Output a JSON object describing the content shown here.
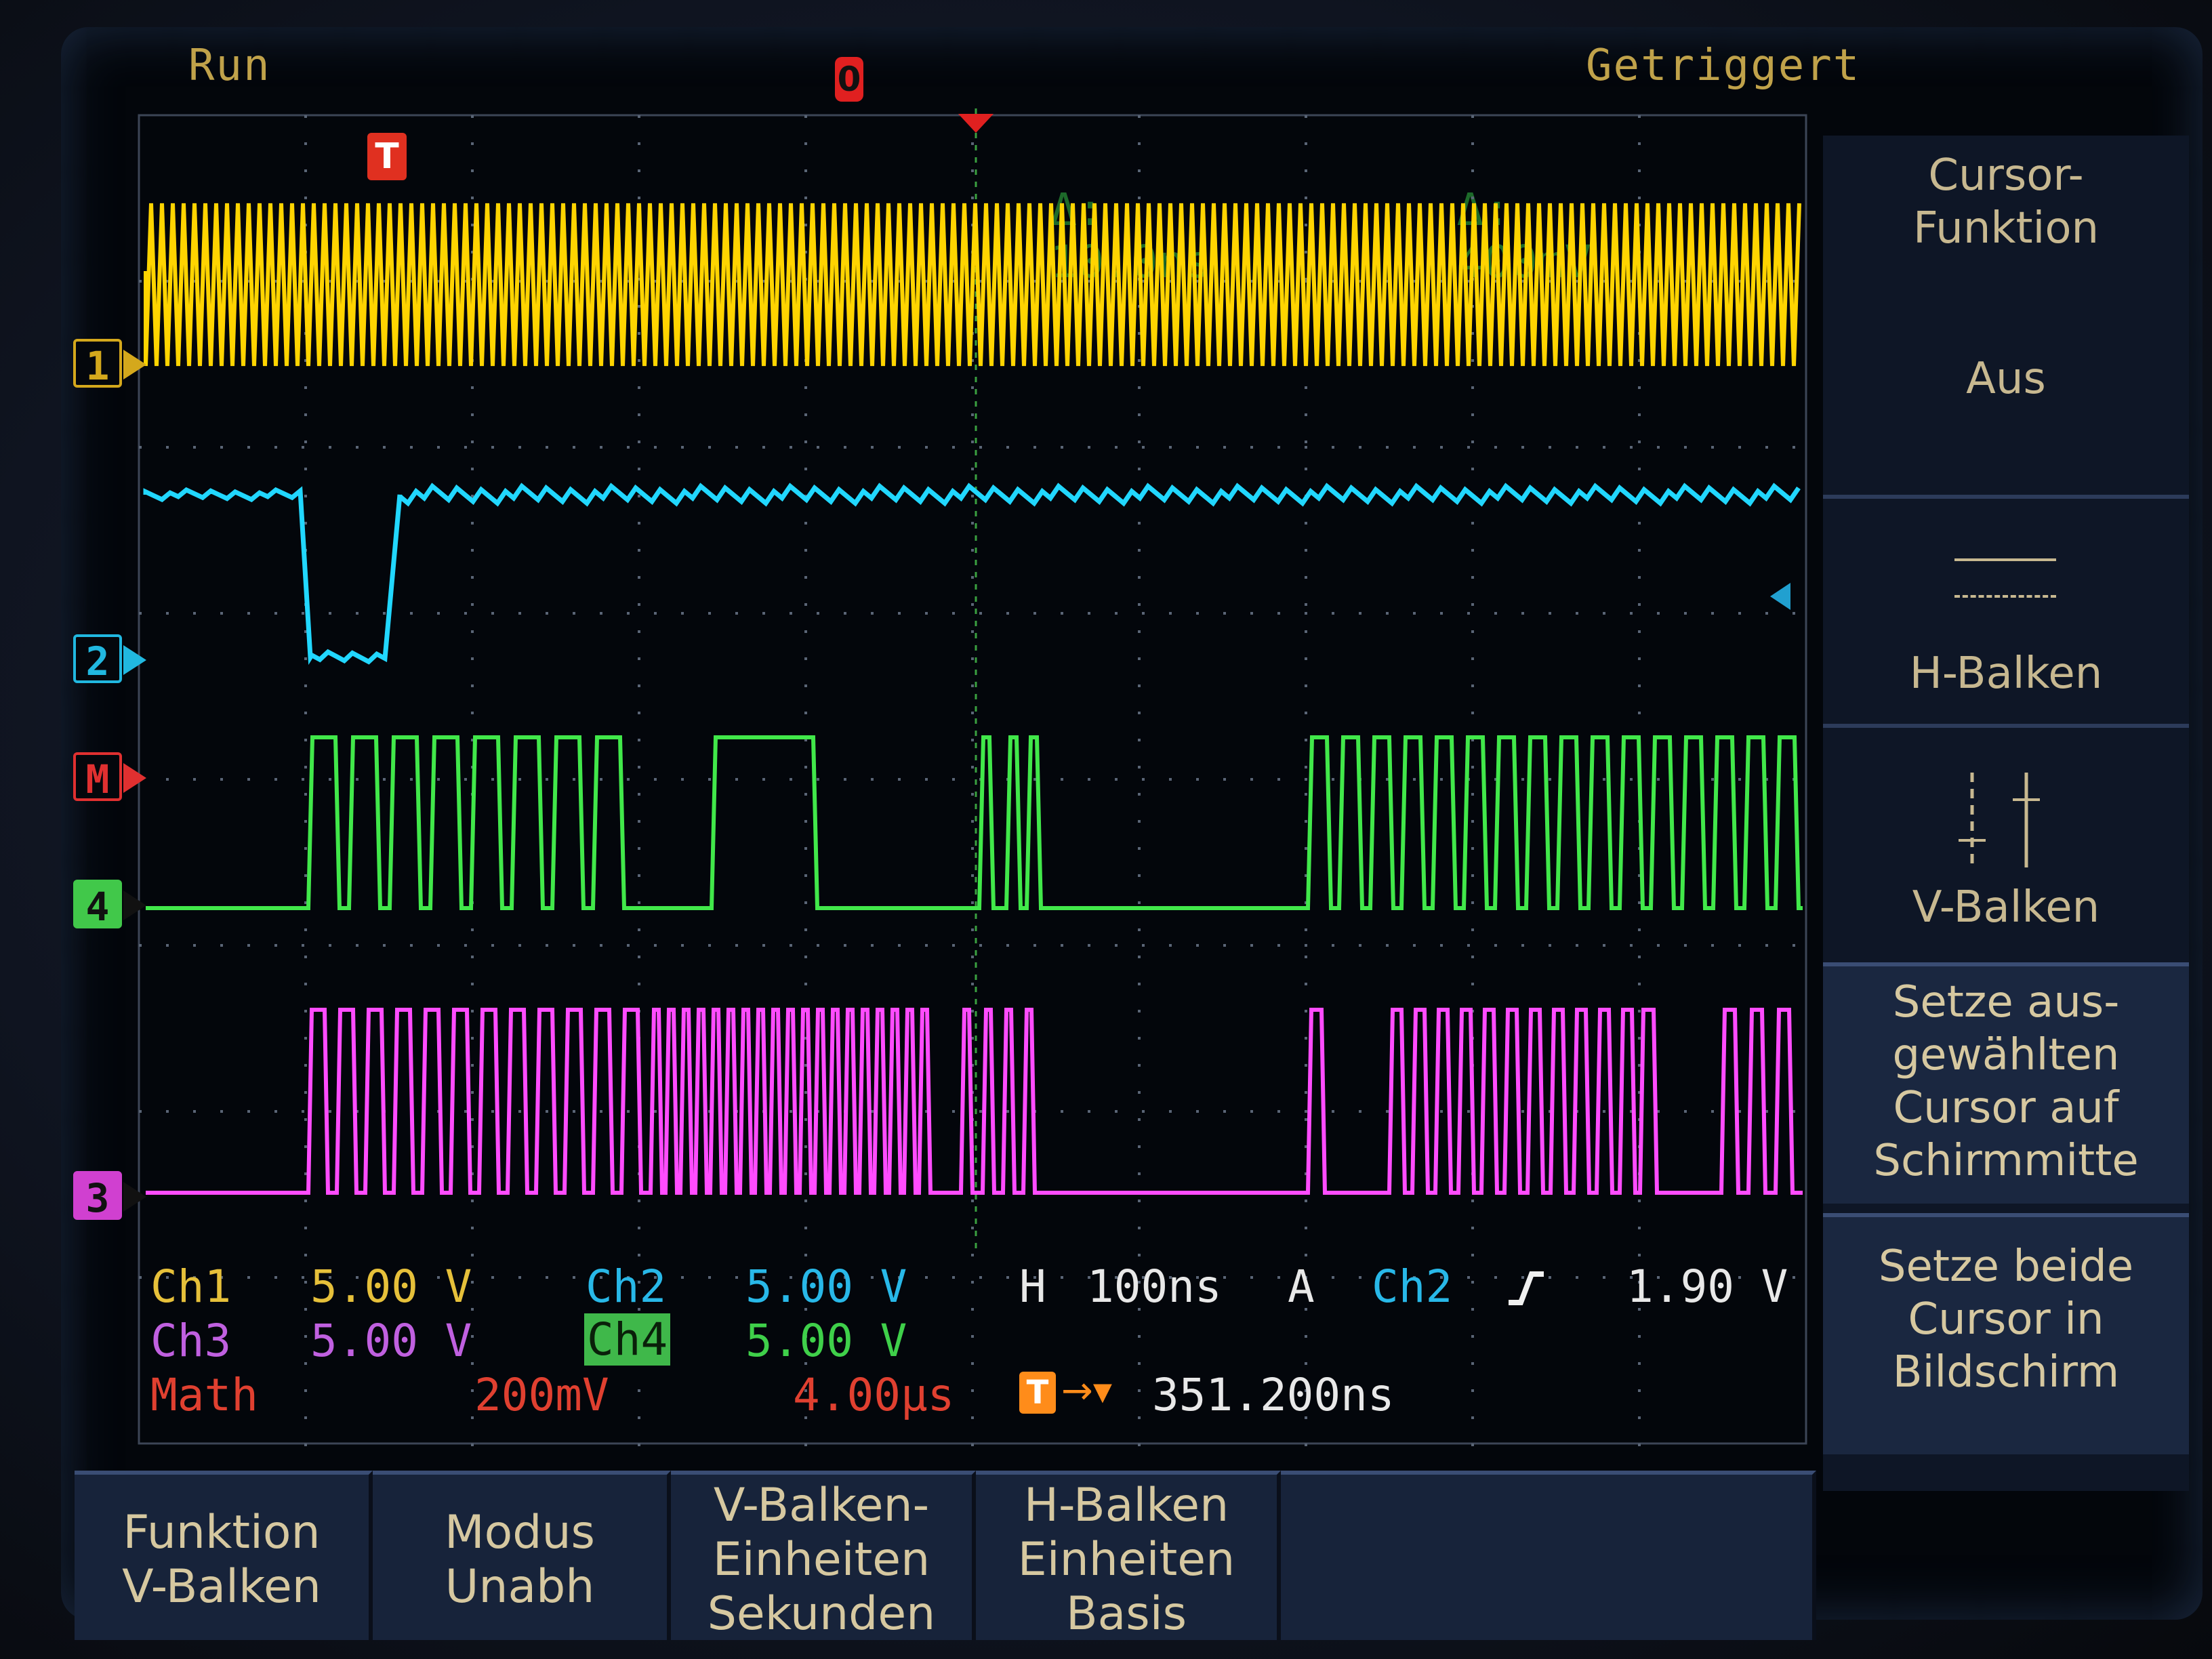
{
  "status": {
    "run": "Run",
    "triggered": "Getriggert",
    "trigger_marker": "T",
    "zero_marker": "0"
  },
  "cursor_readout": {
    "delta_time": "10.0ns",
    "delta_volt": "400mV",
    "delta_symbol": "Δ:"
  },
  "channels": {
    "ch1": {
      "label": "Ch1",
      "scale": "5.00 V",
      "color": "#ffd400",
      "marker": "1"
    },
    "ch2": {
      "label": "Ch2",
      "scale": "5.00 V",
      "color": "#21d7ff",
      "marker": "2"
    },
    "ch3": {
      "label": "Ch3",
      "scale": "5.00 V",
      "color": "#ff4cff",
      "marker": "3"
    },
    "ch4": {
      "label": "Ch4",
      "scale": "5.00 V",
      "color": "#41e84a",
      "marker": "4"
    },
    "math": {
      "label": "Math",
      "scale": "200mV",
      "timebase": "4.00µs",
      "color": "#ff3030",
      "marker": "M"
    }
  },
  "horizontal": {
    "label": "H",
    "value": "100ns",
    "trigger_mode": "A",
    "trigger_source": "Ch2",
    "trigger_level": "1.90 V",
    "slope_icon": "rising-edge-icon"
  },
  "trigger_offset": {
    "value": "351.200ns"
  },
  "side_menu": {
    "title": "Cursor-\nFunktion",
    "state": "Aus",
    "h_bars": "H-Balken",
    "v_bars": "V-Balken",
    "center_selected": "Setze aus-\ngewählten\nCursor auf\nSchirmmitte",
    "both_on_screen": "Setze beide\nCursor in\nBildschirm"
  },
  "bottom_menu": [
    {
      "label": "Funktion\nV-Balken"
    },
    {
      "label": "Modus\nUnabh"
    },
    {
      "label": "V-Balken-\nEinheiten\nSekunden"
    },
    {
      "label": "H-Balken\nEinheiten\nBasis"
    }
  ]
}
